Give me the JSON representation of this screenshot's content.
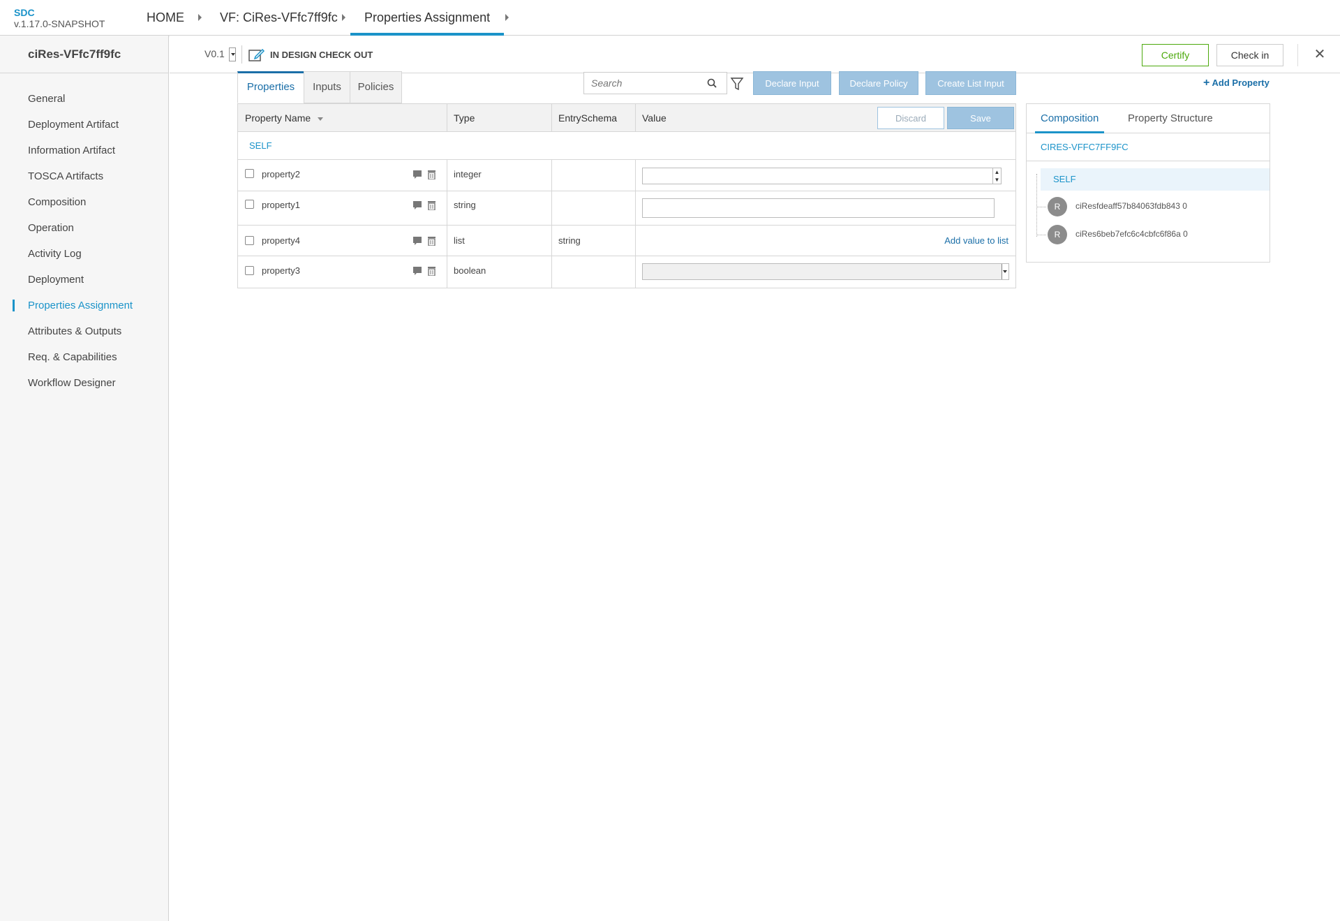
{
  "header": {
    "app_name": "SDC",
    "app_version": "v.1.17.0-SNAPSHOT",
    "breadcrumbs": [
      "HOME",
      "VF: CiRes-VFfc7ff9fc",
      "Properties Assignment"
    ]
  },
  "sidebar": {
    "title": "ciRes-VFfc7ff9fc",
    "items": [
      {
        "label": "General"
      },
      {
        "label": "Deployment Artifact"
      },
      {
        "label": "Information Artifact"
      },
      {
        "label": "TOSCA Artifacts"
      },
      {
        "label": "Composition"
      },
      {
        "label": "Operation"
      },
      {
        "label": "Activity Log"
      },
      {
        "label": "Deployment"
      },
      {
        "label": "Properties Assignment"
      },
      {
        "label": "Attributes & Outputs"
      },
      {
        "label": "Req. & Capabilities"
      },
      {
        "label": "Workflow Designer"
      }
    ],
    "active_index": 8
  },
  "subbar": {
    "version": "V0.1",
    "status": "IN DESIGN CHECK OUT",
    "certify_label": "Certify",
    "checkin_label": "Check in",
    "close_glyph": "✕"
  },
  "tabs": [
    "Properties",
    "Inputs",
    "Policies"
  ],
  "search": {
    "placeholder": "Search"
  },
  "actions": {
    "declare_input": "Declare Input",
    "declare_policy": "Declare Policy",
    "create_list_input": "Create List Input",
    "add_property": "Add Property"
  },
  "table": {
    "headers": {
      "name": "Property Name",
      "type": "Type",
      "schema": "EntrySchema",
      "value": "Value"
    },
    "discard_label": "Discard",
    "save_label": "Save",
    "group_label": "SELF",
    "rows": [
      {
        "name": "property2",
        "type": "integer",
        "schema": "",
        "value_kind": "number"
      },
      {
        "name": "property1",
        "type": "string",
        "schema": "",
        "value_kind": "text"
      },
      {
        "name": "property4",
        "type": "list",
        "schema": "string",
        "value_kind": "list",
        "action": "Add value to list"
      },
      {
        "name": "property3",
        "type": "boolean",
        "schema": "",
        "value_kind": "select"
      }
    ]
  },
  "right_panel": {
    "tabs": [
      "Composition",
      "Property Structure"
    ],
    "title": "CIRES-VFFC7FF9FC",
    "self_label": "SELF",
    "nodes": [
      {
        "badge": "R",
        "label": "ciResfdeaff57b84063fdb843 0"
      },
      {
        "badge": "R",
        "label": "ciRes6beb7efc6c4cbfc6f86a 0"
      }
    ]
  },
  "colors": {
    "accent": "#1b93c9",
    "certify": "#4ca90c",
    "disabled_button": "#9ec3e0"
  }
}
